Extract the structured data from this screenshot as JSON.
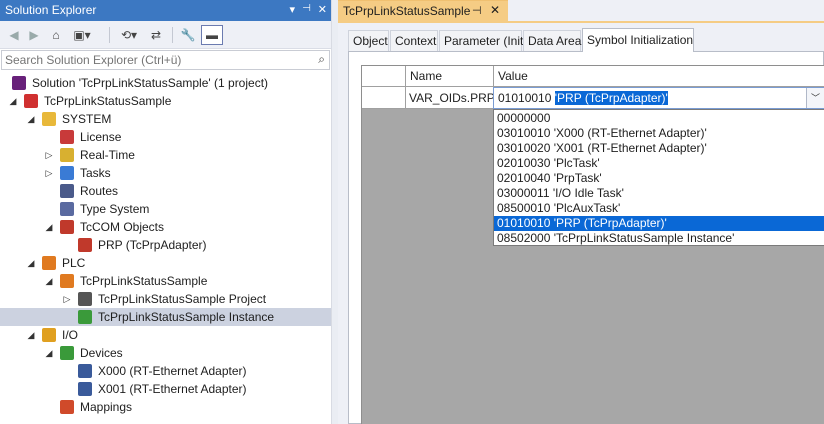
{
  "solution_explorer": {
    "title": "Solution Explorer",
    "title_buttons": [
      "▾",
      "📌",
      "✕"
    ],
    "search_placeholder": "Search Solution Explorer (Ctrl+ü)",
    "tree": [
      {
        "label": "Solution 'TcPrpLinkStatusSample' (1 project)",
        "indent": 0,
        "arrow": "",
        "icon": "solution-icon",
        "color": "#68217a"
      },
      {
        "label": "TcPrpLinkStatusSample",
        "indent": 1,
        "arrow": "◢",
        "icon": "twincat-project-icon",
        "color": "#d03030"
      },
      {
        "label": "SYSTEM",
        "indent": 2,
        "arrow": "◢",
        "icon": "system-icon",
        "color": "#e8b83a"
      },
      {
        "label": "License",
        "indent": 3,
        "arrow": "",
        "icon": "license-icon",
        "color": "#c83a3a"
      },
      {
        "label": "Real-Time",
        "indent": 3,
        "arrow": "▷",
        "icon": "realtime-icon",
        "color": "#d8b030"
      },
      {
        "label": "Tasks",
        "indent": 3,
        "arrow": "▷",
        "icon": "tasks-icon",
        "color": "#3a7bd5"
      },
      {
        "label": "Routes",
        "indent": 3,
        "arrow": "",
        "icon": "routes-icon",
        "color": "#4a5a8a"
      },
      {
        "label": "Type System",
        "indent": 3,
        "arrow": "",
        "icon": "type-system-icon",
        "color": "#5a6aa0"
      },
      {
        "label": "TcCOM Objects",
        "indent": 3,
        "arrow": "◢",
        "icon": "tccom-objects-icon",
        "color": "#c0392b"
      },
      {
        "label": "PRP (TcPrpAdapter)",
        "indent": 4,
        "arrow": "",
        "icon": "prp-object-icon",
        "color": "#c0392b"
      },
      {
        "label": "PLC",
        "indent": 2,
        "arrow": "◢",
        "icon": "plc-icon",
        "color": "#e07a20"
      },
      {
        "label": "TcPrpLinkStatusSample",
        "indent": 3,
        "arrow": "◢",
        "icon": "plc-project-icon",
        "color": "#e07a20"
      },
      {
        "label": "TcPrpLinkStatusSample Project",
        "indent": 4,
        "arrow": "▷",
        "icon": "plc-project-file-icon",
        "color": "#555555"
      },
      {
        "label": "TcPrpLinkStatusSample Instance",
        "indent": 4,
        "arrow": "",
        "icon": "plc-instance-icon",
        "color": "#3a9a3a",
        "selected": true
      },
      {
        "label": "I/O",
        "indent": 2,
        "arrow": "◢",
        "icon": "io-icon",
        "color": "#e0a020"
      },
      {
        "label": "Devices",
        "indent": 3,
        "arrow": "◢",
        "icon": "devices-icon",
        "color": "#3a9a3a"
      },
      {
        "label": "X000 (RT-Ethernet Adapter)",
        "indent": 4,
        "arrow": "",
        "icon": "ethernet-adapter-icon",
        "color": "#3a5a9a"
      },
      {
        "label": "X001 (RT-Ethernet Adapter)",
        "indent": 4,
        "arrow": "",
        "icon": "ethernet-adapter-icon",
        "color": "#3a5a9a"
      },
      {
        "label": "Mappings",
        "indent": 3,
        "arrow": "",
        "icon": "mappings-icon",
        "color": "#d04a2a"
      }
    ]
  },
  "editor": {
    "doc_tab": {
      "title": "TcPrpLinkStatusSample",
      "pin": "⊣",
      "close": "✕"
    },
    "property_tabs": [
      "Object",
      "Context",
      "Parameter (Init)",
      "Data Area",
      "Symbol Initialization"
    ],
    "active_tab": 4,
    "grid": {
      "columns": [
        "Name",
        "Value"
      ],
      "row": {
        "name": "VAR_OIDs.PRP",
        "value_prefix": "01010010",
        "value_selected": "'PRP (TcPrpAdapter)'"
      }
    },
    "dropdown_options": [
      "00000000",
      "03010010 'X000 (RT-Ethernet Adapter)'",
      "03010020 'X001 (RT-Ethernet Adapter)'",
      "02010030 'PlcTask'",
      "02010040 'PrpTask'",
      "03000011 'I/O Idle Task'",
      "08500010 'PlcAuxTask'",
      "01010010 'PRP (TcPrpAdapter)'",
      "08502000 'TcPrpLinkStatusSample Instance'"
    ],
    "selected_option": 7
  },
  "colors": {
    "title_bar": "#3c78c2",
    "doc_tab": "#f5cc84",
    "selection": "#0a68d6",
    "tree_selection": "#ccd2e0"
  }
}
